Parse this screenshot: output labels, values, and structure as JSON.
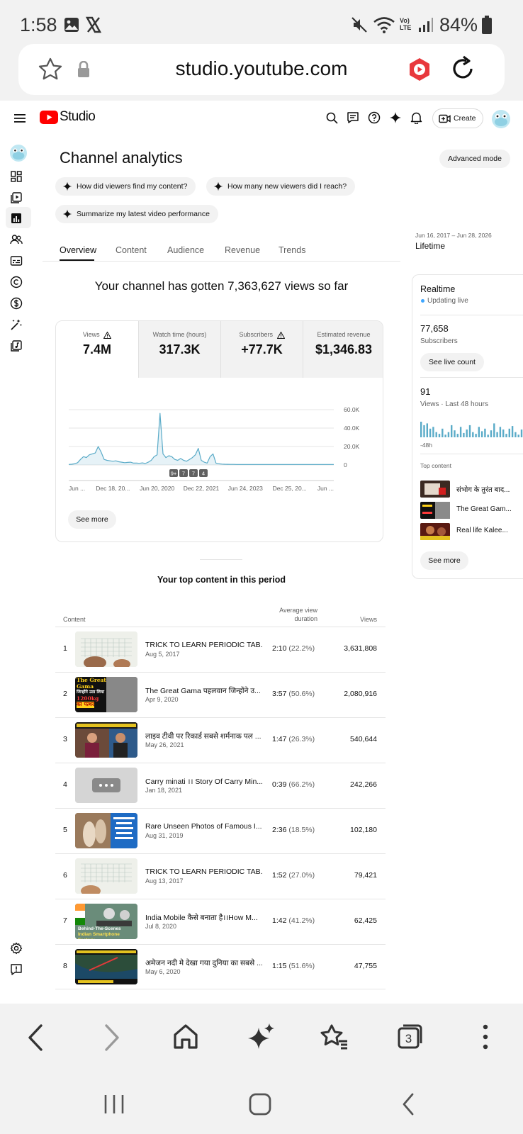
{
  "status": {
    "time": "1:58",
    "battery": "84%",
    "network": "Vo) LTE"
  },
  "browser": {
    "url": "studio.youtube.com",
    "tab_count": "3"
  },
  "yt": {
    "brand": "Studio",
    "create_label": "Create"
  },
  "page": {
    "title": "Channel analytics",
    "advanced_label": "Advanced mode",
    "chips": [
      "How did viewers find my content?",
      "How many new viewers did I reach?",
      "Summarize my latest video performance"
    ],
    "tabs": [
      "Overview",
      "Content",
      "Audience",
      "Revenue",
      "Trends"
    ],
    "date_range": "Jun 16, 2017 – Jun 28, 2026",
    "period": "Lifetime",
    "headline": "Your channel has gotten 7,363,627 views so far",
    "metrics": [
      {
        "label": "Views",
        "value": "7.4M"
      },
      {
        "label": "Watch time (hours)",
        "value": "317.3K"
      },
      {
        "label": "Subscribers",
        "value": "+77.7K"
      },
      {
        "label": "Estimated revenue",
        "value": "$1,346.83"
      }
    ],
    "see_more": "See more",
    "top_content_title": "Your top content in this period",
    "table_headers": {
      "content": "Content",
      "avg_line1": "Average view",
      "avg_line2": "duration",
      "views": "Views"
    }
  },
  "chart_data": {
    "type": "line",
    "x_ticks": [
      "Jun ...",
      "Dec 18, 20...",
      "Jun 20, 2020",
      "Dec 22, 2021",
      "Jun 24, 2023",
      "Dec 25, 20...",
      "Jun ..."
    ],
    "y_ticks": [
      "60.0K",
      "40.0K",
      "20.0K",
      "0"
    ],
    "ylim": [
      0,
      60000
    ],
    "markers": [
      "9+",
      "7",
      "7",
      "4"
    ],
    "series": [
      {
        "values": [
          500,
          800,
          1200,
          2500,
          6000,
          9000,
          8000,
          11000,
          12000,
          13000,
          20000,
          14000,
          6000,
          5000,
          4500,
          4000,
          4500,
          3500,
          3000,
          2500,
          2800,
          3000,
          2000,
          2000,
          1800,
          2200,
          1500,
          3000,
          5000,
          9000,
          11000,
          56000,
          12000,
          8000,
          10000,
          9000,
          6000,
          5000,
          7000,
          5000,
          4000,
          6000,
          8000,
          11000,
          18000,
          5000,
          3000,
          2000,
          9000,
          12000,
          2000,
          1200,
          900,
          800,
          700,
          600,
          600,
          500,
          500,
          500,
          500,
          500,
          500,
          500,
          500,
          500,
          500,
          500,
          500,
          500,
          500,
          500,
          500,
          500,
          500,
          500,
          500,
          500,
          500,
          500,
          500,
          500,
          500,
          500,
          500,
          500,
          500,
          500,
          500,
          500,
          500
        ]
      }
    ],
    "grid": true
  },
  "rows": [
    {
      "rank": "1",
      "title": "TRICK TO LEARN PERIODIC TAB...",
      "date": "Aug 5, 2017",
      "dur": "2:10",
      "pct": "(22.2%)",
      "views": "3,631,808"
    },
    {
      "rank": "2",
      "title": "The Great Gama पहलवान जिन्होंने उ...",
      "date": "Apr 9, 2020",
      "dur": "3:57",
      "pct": "(50.6%)",
      "views": "2,080,916"
    },
    {
      "rank": "3",
      "title": "लाइव टीवी पर रिकार्ड सबसे शर्मनाक पल ...",
      "date": "May 26, 2021",
      "dur": "1:47",
      "pct": "(26.3%)",
      "views": "540,644"
    },
    {
      "rank": "4",
      "title": "Carry minati ।। Story Of Carry Min...",
      "date": "Jan 18, 2021",
      "dur": "0:39",
      "pct": "(66.2%)",
      "views": "242,266"
    },
    {
      "rank": "5",
      "title": "Rare Unseen Photos of Famous I...",
      "date": "Aug 31, 2019",
      "dur": "2:36",
      "pct": "(18.5%)",
      "views": "102,180"
    },
    {
      "rank": "6",
      "title": "TRICK TO LEARN PERIODIC TAB...",
      "date": "Aug 13, 2017",
      "dur": "1:52",
      "pct": "(27.0%)",
      "views": "79,421"
    },
    {
      "rank": "7",
      "title": "India Mobile कैसे बनाता है।।How M...",
      "date": "Jul 8, 2020",
      "dur": "1:42",
      "pct": "(41.2%)",
      "views": "62,425"
    },
    {
      "rank": "8",
      "title": "अमेजन नदी मे देखा गया दुनिया का सबसे ...",
      "date": "May 6, 2020",
      "dur": "1:15",
      "pct": "(51.6%)",
      "views": "47,755"
    }
  ],
  "thumb_text": {
    "t2a": "The Great",
    "t2b": "Gama",
    "t2c": "जिन्होंने उठा लिया",
    "t2d": "1200kg",
    "t2e": "का पत्थर",
    "t7a": "Behind-The-Scenes",
    "t7b": "Indian Smartphone Factory"
  },
  "realtime": {
    "title": "Realtime",
    "live": "Updating live",
    "subs_value": "77,658",
    "subs_label": "Subscribers",
    "live_count_btn": "See live count",
    "views_value": "91",
    "views_label": "Views · Last 48 hours",
    "axis_left": "-48h",
    "axis_right": "N",
    "top_content": "Top content",
    "top_content_right": "Vi",
    "items": [
      "संभोग के तुरंत बाद...",
      "The Great Gam...",
      "Real life Kalee..."
    ],
    "bars": [
      18,
      14,
      16,
      10,
      12,
      6,
      4,
      10,
      3,
      6,
      14,
      8,
      4,
      12,
      5,
      9,
      14,
      6,
      4,
      12,
      7,
      10,
      3,
      8,
      16,
      6,
      12,
      9,
      4,
      10,
      13,
      6,
      3,
      9,
      4,
      14,
      8
    ]
  },
  "colors": {
    "accent": "#5aabc8",
    "yt_red": "#ff0000",
    "live_dot": "#3ea6ff",
    "brave_red": "#e8383d"
  }
}
